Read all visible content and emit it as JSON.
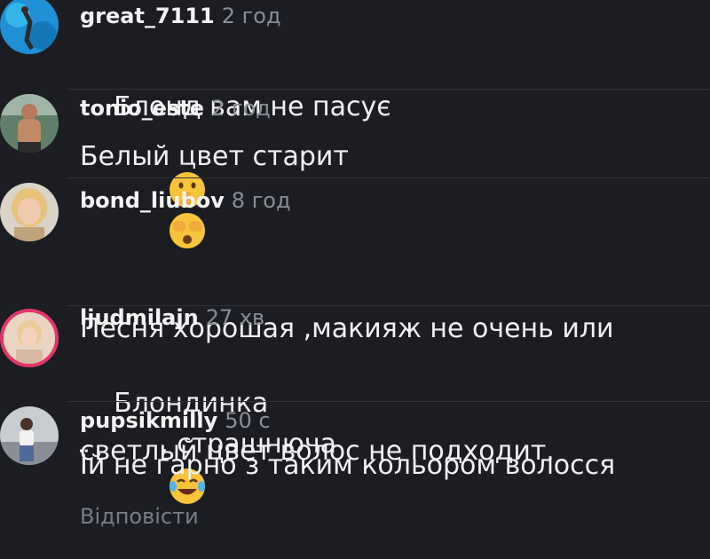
{
  "comments": [
    {
      "username": "great_7111",
      "time": "2 год",
      "text": "Блонд вам не пасує",
      "emoji": [
        "shushing-face-emoji",
        "face-with-hands-over-eyes-emoji"
      ]
    },
    {
      "username": "tonio_este",
      "time": "2 год",
      "text": "Белый цвет старит"
    },
    {
      "username": "bond_liubov",
      "time": "8 год",
      "text_line1": "Песня хорошая ,макияж не очень или",
      "text_line2": "светлый цвет волос не подходит."
    },
    {
      "username": "ljudmilajn",
      "time": "27 хв",
      "text_before": "Блондинка",
      "text_after": ", страшнюча",
      "emoji": [
        "face-with-tears-of-joy-emoji"
      ]
    },
    {
      "username": "pupsikmilly",
      "time": "50 с",
      "text": "Їй не гарно з таким кольором волосся"
    }
  ],
  "reply_label": "Відповісти",
  "colors": {
    "background": "#1c1d22",
    "username": "#f4f4f4",
    "timestamp": "#8a8d96",
    "story_ring": "#e3366b",
    "reply": "#7a7d86"
  }
}
